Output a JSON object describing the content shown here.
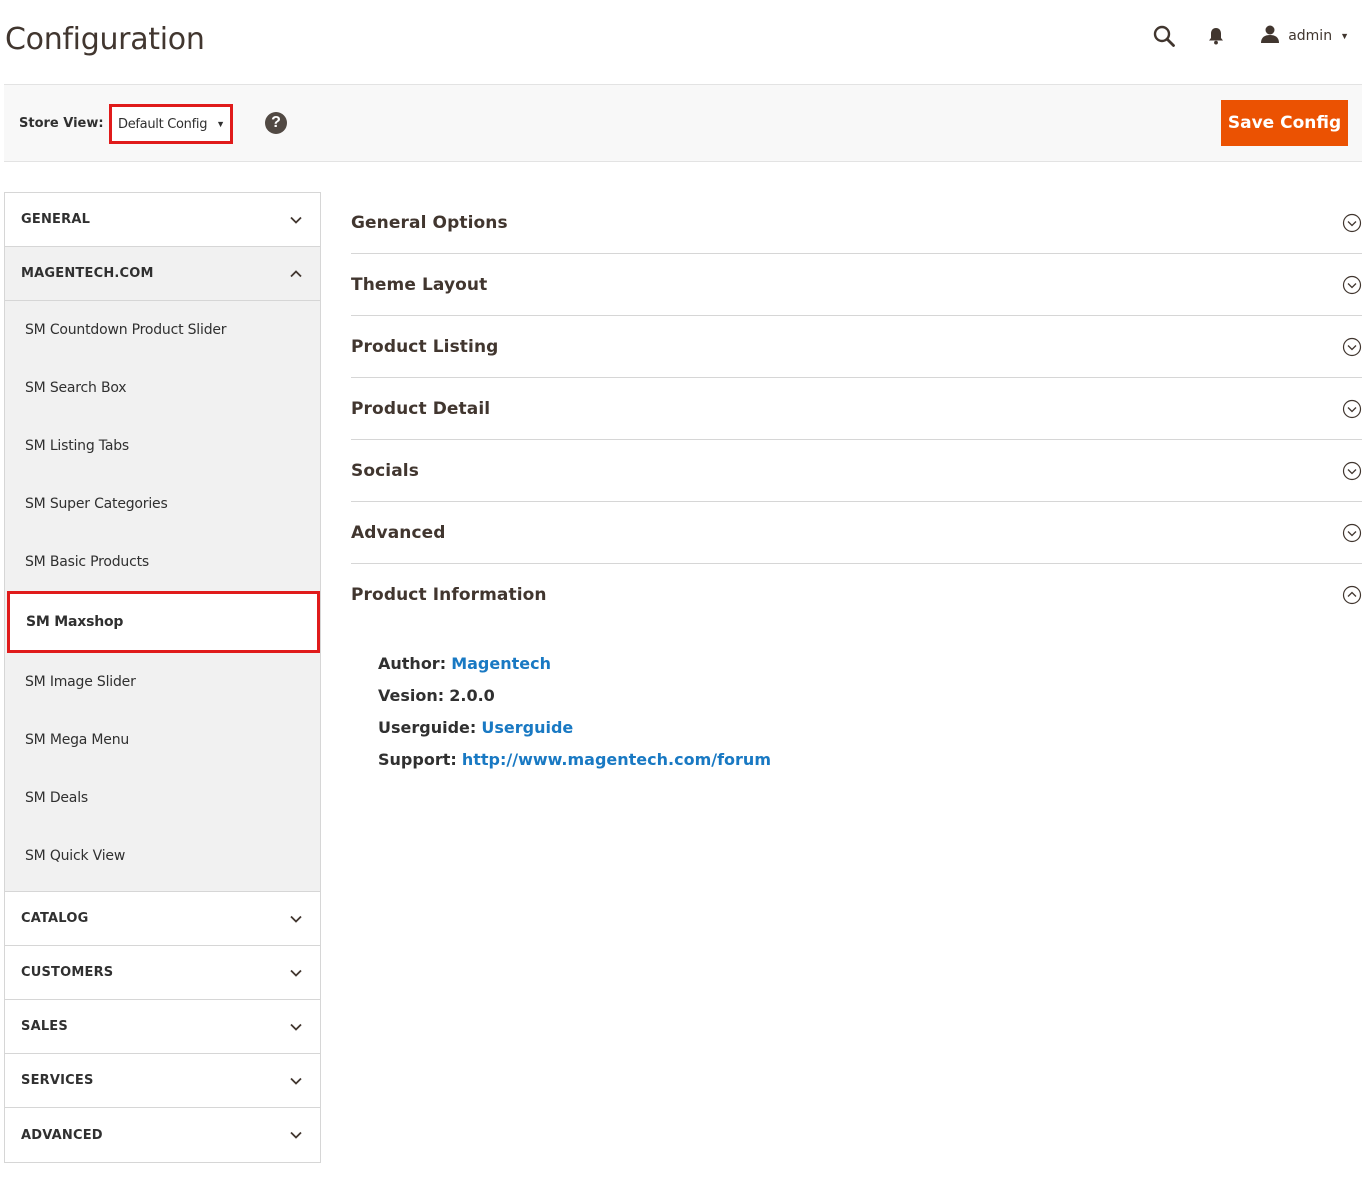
{
  "header": {
    "title": "Configuration",
    "user_name": "admin"
  },
  "store_bar": {
    "label": "Store View:",
    "selected": "Default Config",
    "help": "?",
    "save_label": "Save Config"
  },
  "colors": {
    "accent": "#eb5202",
    "highlight": "#e01b1b",
    "link": "#1979c3"
  },
  "sidebar": {
    "tabs_top": [
      {
        "label": "GENERAL",
        "state": "collapsed"
      },
      {
        "label": "MAGENTECH.COM",
        "state": "expanded"
      }
    ],
    "magentech_items": [
      "SM Countdown Product Slider",
      "SM Search Box",
      "SM Listing Tabs",
      "SM Super Categories",
      "SM Basic Products",
      "SM Maxshop",
      "SM Image Slider",
      "SM Mega Menu",
      "SM Deals",
      "SM Quick View"
    ],
    "active_item": "SM Maxshop",
    "tabs_bottom": [
      {
        "label": "CATALOG"
      },
      {
        "label": "CUSTOMERS"
      },
      {
        "label": "SALES"
      },
      {
        "label": "SERVICES"
      },
      {
        "label": "ADVANCED"
      }
    ]
  },
  "sections": [
    {
      "title": "General Options",
      "state": "collapsed"
    },
    {
      "title": "Theme Layout",
      "state": "collapsed"
    },
    {
      "title": "Product Listing",
      "state": "collapsed"
    },
    {
      "title": "Product Detail",
      "state": "collapsed"
    },
    {
      "title": "Socials",
      "state": "collapsed"
    },
    {
      "title": "Advanced",
      "state": "collapsed"
    },
    {
      "title": "Product Information",
      "state": "expanded"
    }
  ],
  "product_info": {
    "author_label": "Author:",
    "author_value": "Magentech",
    "version_label": "Vesion:",
    "version_value": "2.0.0",
    "userguide_label": "Userguide:",
    "userguide_value": "Userguide",
    "support_label": "Support:",
    "support_value": "http://www.magentech.com/forum"
  }
}
